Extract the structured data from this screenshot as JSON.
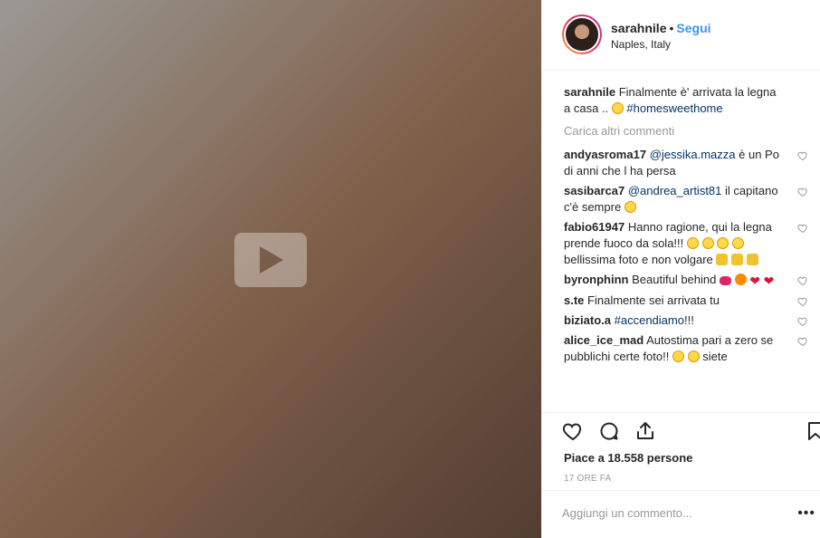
{
  "post": {
    "image_alt": "Foto",
    "username": "sarahnile",
    "separator": "•",
    "follow_label": "Segui",
    "location": "Naples, Italy"
  },
  "caption": {
    "username": "sarahnile",
    "text": "Finalmente è' arrivata la legna a casa ..",
    "hashtag": "#homesweethome"
  },
  "load_more": "Carica altri commenti",
  "comments": [
    {
      "user": "andyasroma17",
      "mention": "@jessika.mazza",
      "text": " è un Po di anni che l ha persa"
    },
    {
      "user": "sasibarca7",
      "mention": "@andrea_artist81",
      "text": " il capitano c'è sempre"
    },
    {
      "user": "fabio61947",
      "text": "Hanno ragione, qui la legna prende fuoco da sola!!!",
      "text2": " bellissima foto e non volgare"
    },
    {
      "user": "byronphinn",
      "text": "Beautiful behind"
    },
    {
      "user": "s.te",
      "text": "Finalmente sei arrivata tu"
    },
    {
      "user": "biziato.a",
      "hashtag": "#accendiamo",
      "text": "!!!"
    },
    {
      "user": "alice_ice_mad",
      "text": "Autostima pari a zero se pubblichi certe foto!!",
      "text2": "siete"
    }
  ],
  "likes": "Piace a 18.558 persone",
  "timestamp": "17 ORE FA",
  "add_comment_placeholder": "Aggiungi un commento...",
  "more_options": "•••",
  "icons": [
    "heart-icon",
    "comment-icon",
    "share-icon",
    "bookmark-icon",
    "heart-small-icon"
  ],
  "colors": {
    "accent": "#3897f0",
    "hashtag": "#003569",
    "muted": "#999999"
  }
}
